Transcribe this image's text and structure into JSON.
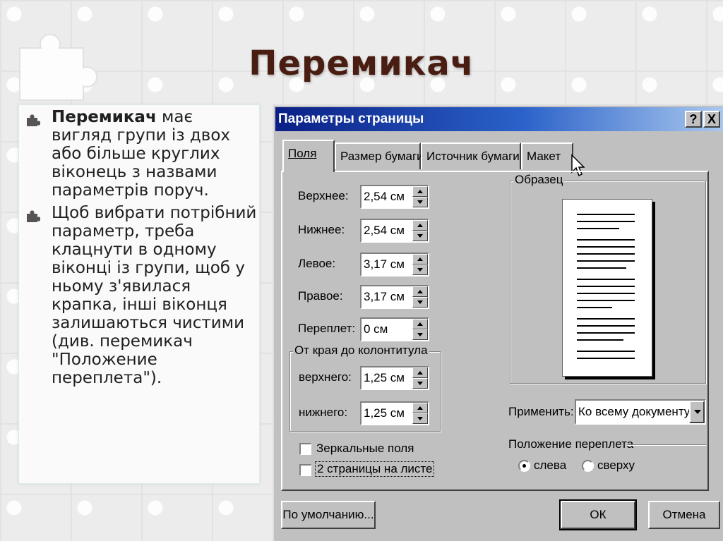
{
  "slide": {
    "title": "Перемикач",
    "bullets": [
      {
        "bold": "Перемикач",
        "text": " має вигляд групи із двох або більше круглих віконець з назвами параметрів поруч."
      },
      {
        "bold": "",
        "text": "Щоб вибрати потрібний параметр, треба клацнути в одному віконці із групи, щоб у ньому з'явилася крапка, інші віконця залишаються чистими (див. перемикач \"Положение переплета\")."
      }
    ]
  },
  "dialog": {
    "title": "Параметры страницы",
    "help_label": "?",
    "close_label": "X",
    "tabs": [
      {
        "label": "Поля",
        "active": true
      },
      {
        "label": "Размер бумаги",
        "active": false
      },
      {
        "label": "Источник бумаги",
        "active": false
      },
      {
        "label": "Макет",
        "active": false
      }
    ],
    "fields": {
      "top": {
        "label": "Верхнее:",
        "value": "2,54 см"
      },
      "bottom": {
        "label": "Нижнее:",
        "value": "2,54 см"
      },
      "left": {
        "label": "Левое:",
        "value": "3,17 см"
      },
      "right": {
        "label": "Правое:",
        "value": "3,17 см"
      },
      "gutter": {
        "label": "Переплет:",
        "value": "0 см"
      }
    },
    "header_footer_group": {
      "label": "От края до колонтитула",
      "header": {
        "label": "верхнего:",
        "value": "1,25 см"
      },
      "footer": {
        "label": "нижнего:",
        "value": "1,25 см"
      }
    },
    "preview_label": "Образец",
    "apply_label": "Применить:",
    "apply_value": "Ко всему документу",
    "checkboxes": [
      {
        "label": "Зеркальные поля",
        "checked": false
      },
      {
        "label": "2 страницы на листе",
        "checked": false
      }
    ],
    "gutter_position": {
      "label": "Положение переплета",
      "options": [
        {
          "label": "слева",
          "checked": true
        },
        {
          "label": "сверху",
          "checked": false
        }
      ]
    },
    "buttons": {
      "default": "По умолчанию...",
      "ok": "ОК",
      "cancel": "Отмена"
    }
  },
  "colors": {
    "title_color": "#4a1d12",
    "dialog_face": "#c0c0c0",
    "titlebar_start": "#0a1f85",
    "titlebar_end": "#a9c8ee"
  }
}
